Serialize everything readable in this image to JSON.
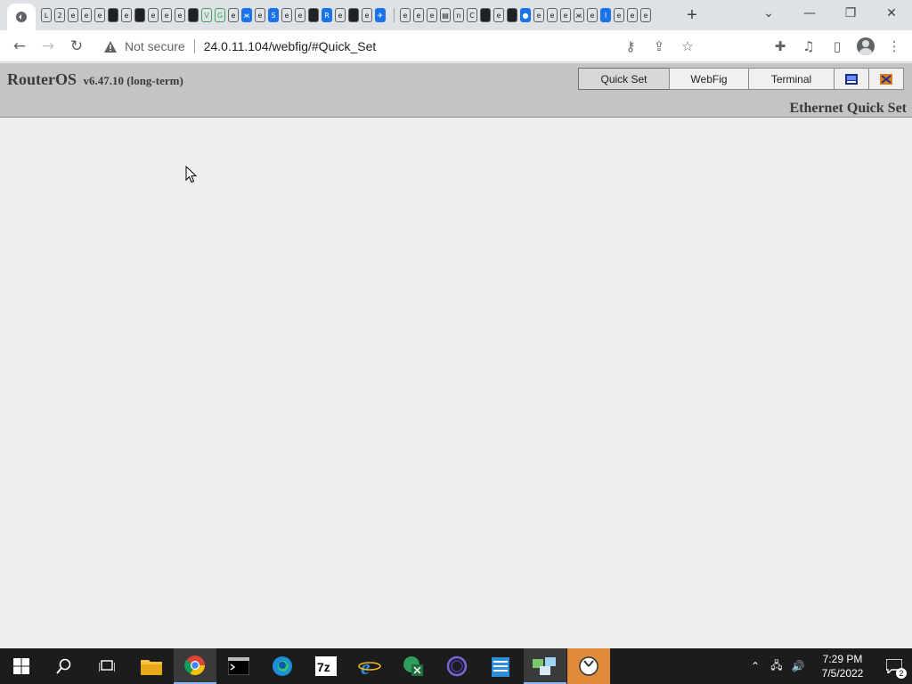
{
  "browser": {
    "security_label": "Not secure",
    "url": "24.0.11.104/webfig/#Quick_Set",
    "new_tab_glyph": "+"
  },
  "routeros": {
    "title": "RouterOS",
    "version": "v6.47.10 (long-term)",
    "tabs": [
      {
        "label": "Quick Set",
        "active": true
      },
      {
        "label": "WebFig",
        "active": false
      },
      {
        "label": "Terminal",
        "active": false
      }
    ],
    "page_title": "Ethernet Quick Set"
  },
  "taskbar": {
    "time": "7:29 PM",
    "date": "7/5/2022",
    "notification_count": "2",
    "apps": [
      "start-icon",
      "search-icon",
      "task-view-icon",
      "file-explorer-icon",
      "chrome-icon",
      "terminal-icon",
      "edge-icon",
      "7zip-icon",
      "internet-explorer-icon",
      "excel-icon",
      "cortana-icon",
      "notepad-icon",
      "network-tool-icon",
      "clock-app-icon"
    ]
  },
  "colors": {
    "header_bg": "#c4c4c4",
    "content_bg": "#efefef",
    "taskbar_bg": "#1c1c1c"
  }
}
